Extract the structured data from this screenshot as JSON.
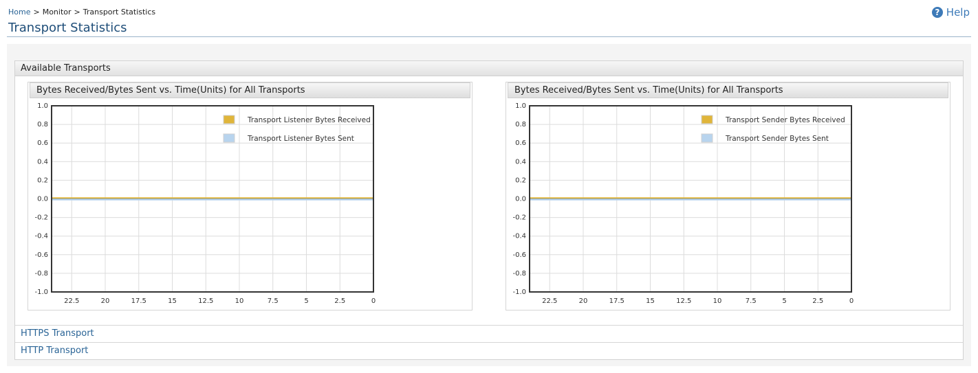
{
  "breadcrumb": {
    "home": "Home",
    "sep1": ">",
    "monitor": "Monitor",
    "sep2": ">",
    "current": "Transport Statistics"
  },
  "help": {
    "label": "Help",
    "icon": "help-circle-icon"
  },
  "page": {
    "title": "Transport Statistics"
  },
  "section": {
    "title": "Available Transports"
  },
  "transports": [
    {
      "label": "HTTPS Transport"
    },
    {
      "label": "HTTP Transport"
    }
  ],
  "chart_data": [
    {
      "type": "line",
      "title": "Bytes Received/Bytes Sent vs. Time(Units) for All Transports",
      "xlabel": "",
      "ylabel": "",
      "x_ticks": [
        "22.5",
        "20",
        "17.5",
        "15",
        "12.5",
        "10",
        "7.5",
        "5",
        "2.5",
        "0"
      ],
      "y_ticks": [
        "1.0",
        "0.8",
        "0.6",
        "0.4",
        "0.2",
        "0.0",
        "-0.2",
        "-0.4",
        "-0.6",
        "-0.8",
        "-1.0"
      ],
      "xlim": [
        24,
        0
      ],
      "ylim": [
        -1.0,
        1.0
      ],
      "grid": true,
      "legend_position": "top-right",
      "series": [
        {
          "name": "Transport Listener Bytes Received",
          "color": "#e0b53a",
          "x": [
            24,
            0
          ],
          "y": [
            0,
            0
          ]
        },
        {
          "name": "Transport Listener Bytes Sent",
          "color": "#b8d4ee",
          "x": [
            24,
            0
          ],
          "y": [
            0,
            0
          ]
        }
      ]
    },
    {
      "type": "line",
      "title": "Bytes Received/Bytes Sent vs. Time(Units) for All Transports",
      "xlabel": "",
      "ylabel": "",
      "x_ticks": [
        "22.5",
        "20",
        "17.5",
        "15",
        "12.5",
        "10",
        "7.5",
        "5",
        "2.5",
        "0"
      ],
      "y_ticks": [
        "1.0",
        "0.8",
        "0.6",
        "0.4",
        "0.2",
        "0.0",
        "-0.2",
        "-0.4",
        "-0.6",
        "-0.8",
        "-1.0"
      ],
      "xlim": [
        24,
        0
      ],
      "ylim": [
        -1.0,
        1.0
      ],
      "grid": true,
      "legend_position": "top-right",
      "series": [
        {
          "name": "Transport Sender Bytes Received",
          "color": "#e0b53a",
          "x": [
            24,
            0
          ],
          "y": [
            0,
            0
          ]
        },
        {
          "name": "Transport Sender Bytes Sent",
          "color": "#b8d4ee",
          "x": [
            24,
            0
          ],
          "y": [
            0,
            0
          ]
        }
      ]
    }
  ]
}
